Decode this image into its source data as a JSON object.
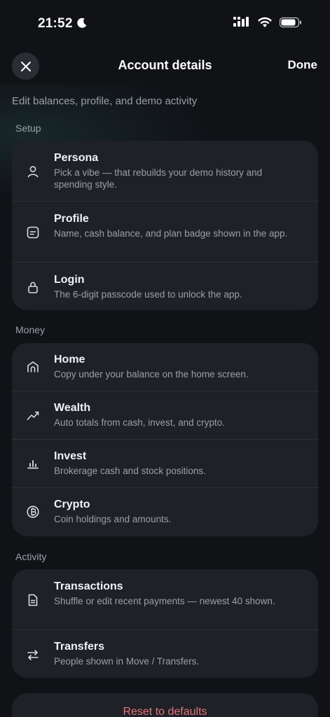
{
  "status": {
    "time": "21:52"
  },
  "nav": {
    "title": "Account details",
    "done_label": "Done"
  },
  "subtitle": "Edit balances, profile, and demo activity",
  "sections": {
    "setup": {
      "label": "Setup",
      "items": [
        {
          "title": "Persona",
          "desc": "Pick a vibe — that rebuilds your demo history and spending style.",
          "icon": "person-icon"
        },
        {
          "title": "Profile",
          "desc": "Name, cash balance, and plan badge shown in the app.",
          "icon": "id-card-icon"
        },
        {
          "title": "Login",
          "desc": "The 6-digit passcode used to unlock the app.",
          "icon": "lock-icon"
        }
      ]
    },
    "money": {
      "label": "Money",
      "items": [
        {
          "title": "Home",
          "desc": "Copy under your balance on the home screen.",
          "icon": "home-icon"
        },
        {
          "title": "Wealth",
          "desc": "Auto totals from cash, invest, and crypto.",
          "icon": "trend-icon"
        },
        {
          "title": "Invest",
          "desc": "Brokerage cash and stock positions.",
          "icon": "bar-chart-icon"
        },
        {
          "title": "Crypto",
          "desc": "Coin holdings and amounts.",
          "icon": "coin-icon"
        }
      ]
    },
    "activity": {
      "label": "Activity",
      "items": [
        {
          "title": "Transactions",
          "desc": "Shuffle or edit recent payments — newest 40 shown.",
          "icon": "document-icon"
        },
        {
          "title": "Transfers",
          "desc": "People shown in Move / Transfers.",
          "icon": "transfer-arrows-icon"
        }
      ]
    }
  },
  "reset_label": "Reset to defaults",
  "colors": {
    "background": "#101216",
    "card": "#1e2127",
    "danger": "#e8727a"
  }
}
